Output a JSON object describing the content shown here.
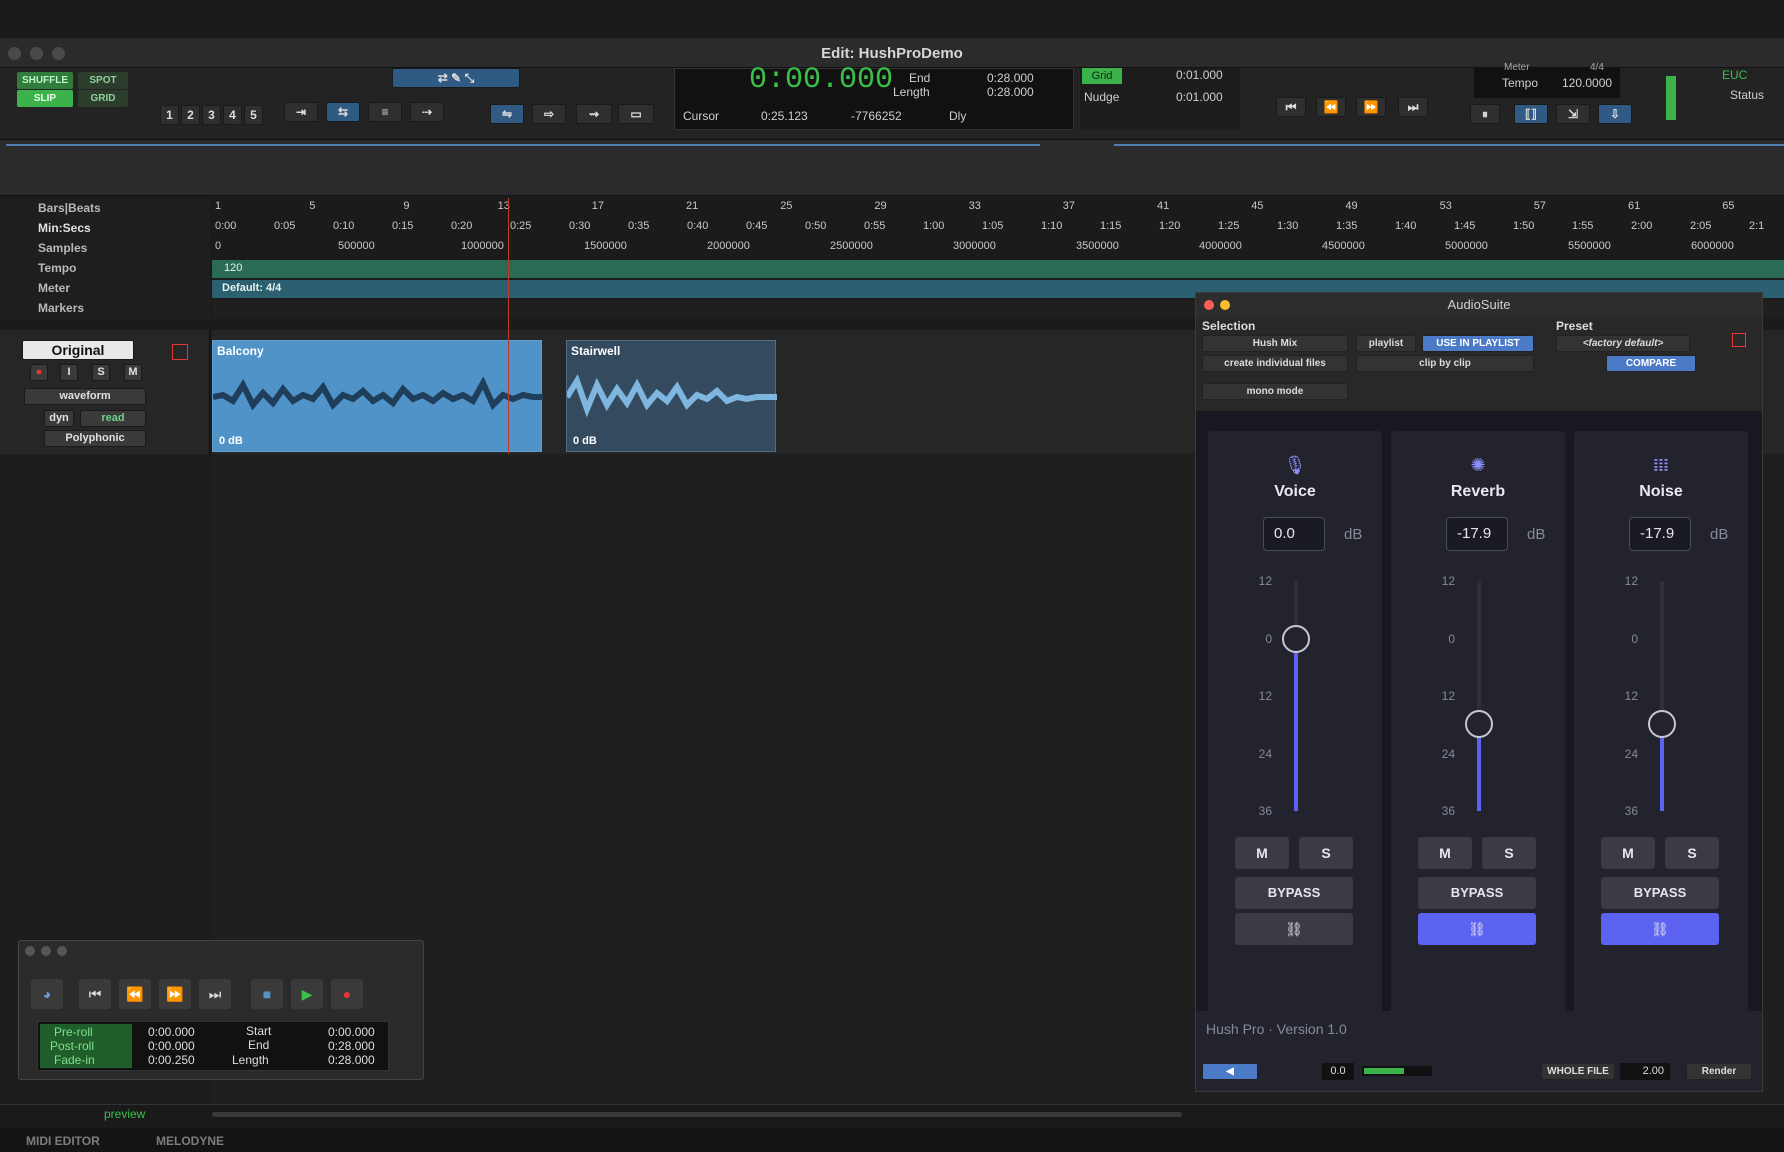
{
  "window": {
    "title": "Edit: HushProDemo"
  },
  "toolbar": {
    "modes": {
      "shuffle": "SHUFFLE",
      "spot": "SPOT",
      "slip": "SLIP",
      "grid": "GRID"
    },
    "zoom_presets": [
      "1",
      "2",
      "3",
      "4",
      "5"
    ],
    "main_counter": "0:00.000",
    "end_label": "End",
    "end_value": "0:28.000",
    "length_label": "Length",
    "length_value": "0:28.000",
    "cursor_label": "Cursor",
    "cursor_value": "0:25.123",
    "cursor_sample": "-7766252",
    "dly_label": "Dly",
    "grid_label": "Grid",
    "grid_value": "0:01.000",
    "nudge_label": "Nudge",
    "nudge_value": "0:01.000",
    "meter_label": "Meter",
    "meter_value": "4/4",
    "tempo_label": "Tempo",
    "tempo_value": "120.0000",
    "euc_label": "EUC",
    "status_label": "Status"
  },
  "rulers": {
    "labels": [
      "Bars|Beats",
      "Min:Secs",
      "Samples",
      "Tempo",
      "Meter",
      "Markers"
    ],
    "bars": [
      "1",
      "5",
      "9",
      "13",
      "17",
      "21",
      "25",
      "29",
      "33",
      "37",
      "41",
      "45",
      "49",
      "53",
      "57",
      "61",
      "65"
    ],
    "minsecs": [
      "0:00",
      "0:05",
      "0:10",
      "0:15",
      "0:20",
      "0:25",
      "0:30",
      "0:35",
      "0:40",
      "0:45",
      "0:50",
      "0:55",
      "1:00",
      "1:05",
      "1:10",
      "1:15",
      "1:20",
      "1:25",
      "1:30",
      "1:35",
      "1:40",
      "1:45",
      "1:50",
      "1:55",
      "2:00",
      "2:05",
      "2:1"
    ],
    "samples": [
      "0",
      "500000",
      "1000000",
      "1500000",
      "2000000",
      "2500000",
      "3000000",
      "3500000",
      "4000000",
      "4500000",
      "5000000",
      "5500000",
      "6000000"
    ],
    "tempo_value": "120",
    "meter_value": "Default: 4/4"
  },
  "track": {
    "name": "Original",
    "view": "waveform",
    "automation": "read",
    "dyn": "dyn",
    "elastic": "Polyphonic",
    "rec": "",
    "input": "I",
    "solo": "S",
    "mute": "M"
  },
  "clips": [
    {
      "name": "Balcony",
      "gain": "0 dB"
    },
    {
      "name": "Stairwell",
      "gain": "0 dB"
    }
  ],
  "audiosuite": {
    "title": "AudioSuite",
    "selection_label": "Selection",
    "preset_label": "Preset",
    "plugin": "Hush Mix",
    "playlist": "playlist",
    "use_in_playlist": "USE IN PLAYLIST",
    "factory_default": "<factory default>",
    "create_files": "create individual files",
    "clip_by_clip": "clip by clip",
    "compare": "COMPARE",
    "mono_mode": "mono mode",
    "version": "Hush Pro · Version 1.0",
    "whole_file": "WHOLE FILE",
    "handle_value": "2.00",
    "render": "Render",
    "level_value": "0.0",
    "scale": [
      "12",
      "0",
      "12",
      "24",
      "36"
    ],
    "panels": [
      {
        "name": "Voice",
        "value": "0.0",
        "unit": "dB",
        "mute": "M",
        "solo": "S",
        "bypass": "BYPASS",
        "link_on": false,
        "level_db": 0.0
      },
      {
        "name": "Reverb",
        "value": "-17.9",
        "unit": "dB",
        "mute": "M",
        "solo": "S",
        "bypass": "BYPASS",
        "link_on": true,
        "level_db": -17.9
      },
      {
        "name": "Noise",
        "value": "-17.9",
        "unit": "dB",
        "mute": "M",
        "solo": "S",
        "bypass": "BYPASS",
        "link_on": true,
        "level_db": -17.9
      }
    ]
  },
  "transport": {
    "preroll_label": "Pre-roll",
    "preroll_value": "0:00.000",
    "postroll_label": "Post-roll",
    "postroll_value": "0:00.000",
    "fadein_label": "Fade-in",
    "fadein_value": "0:00.250",
    "start_label": "Start",
    "start_value": "0:00.000",
    "end_label": "End",
    "end_value": "0:28.000",
    "length_label": "Length",
    "length_value": "0:28.000"
  },
  "bottom": {
    "preview": "preview",
    "tabs": [
      "MIDI EDITOR",
      "MELODYNE"
    ]
  },
  "colors": {
    "accent": "#5c63f0",
    "clip_blue": "#4f93c9",
    "tempo_green": "#2a6b56",
    "record_red": "#e53935",
    "play_green": "#39c24a"
  }
}
